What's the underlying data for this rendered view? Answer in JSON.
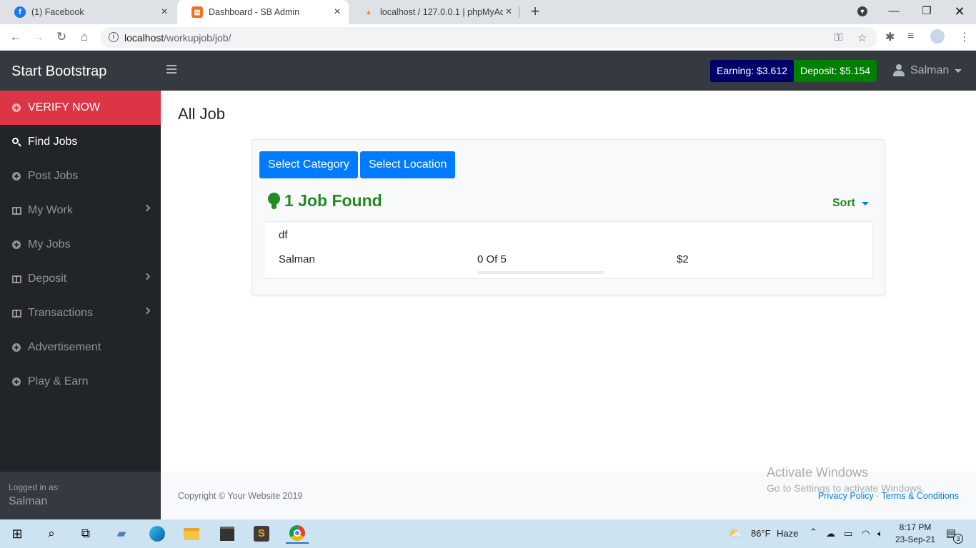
{
  "browser": {
    "tabs": [
      {
        "title": "(1) Facebook",
        "active": false
      },
      {
        "title": "Dashboard - SB Admin",
        "active": true
      },
      {
        "title": "localhost / 127.0.0.1 | phpMyAdm",
        "active": false
      }
    ],
    "url_host": "localhost",
    "url_path": "/workupjob/job/"
  },
  "topbar": {
    "brand": "Start Bootstrap",
    "earning": "Earning: $3.612",
    "deposit": "Deposit: $5.154",
    "user": "Salman",
    "colors": {
      "earning_bg": "#00006b",
      "deposit_bg": "#008000",
      "verify_bg": "#dc3545"
    }
  },
  "sidebar": {
    "items": [
      {
        "label": "VERIFY NOW",
        "icon": "plus-circle-icon"
      },
      {
        "label": "Find Jobs",
        "icon": "search-icon"
      },
      {
        "label": "Post Jobs",
        "icon": "plus-circle-icon"
      },
      {
        "label": "My Work",
        "icon": "columns-icon"
      },
      {
        "label": "My Jobs",
        "icon": "plus-circle-icon"
      },
      {
        "label": "Deposit",
        "icon": "columns-icon"
      },
      {
        "label": "Transactions",
        "icon": "columns-icon"
      },
      {
        "label": "Advertisement",
        "icon": "plus-circle-icon"
      },
      {
        "label": "Play & Earn",
        "icon": "plus-circle-icon"
      }
    ],
    "footer_label": "Logged in as:",
    "footer_user": "Salman"
  },
  "main": {
    "title": "All Job",
    "select_category": "Select Category",
    "select_location": "Select Location",
    "jobs_found": "1 Job Found",
    "sort": "Sort",
    "jobs": [
      {
        "title": "df",
        "owner": "Salman",
        "progress": "0 Of 5",
        "progress_fraction": 0,
        "pay": "$2"
      }
    ]
  },
  "footer": {
    "copyright": "Copyright © Your Website 2019",
    "privacy": "Privacy Policy",
    "separator": "·",
    "terms": "Terms & Conditions"
  },
  "watermark": {
    "line1": "Activate Windows",
    "line2": "Go to Settings to activate Windows."
  },
  "taskbar": {
    "temperature": "86°F",
    "weather": "Haze",
    "time": "8:17 PM",
    "date": "23-Sep-21",
    "notifications": "3"
  }
}
